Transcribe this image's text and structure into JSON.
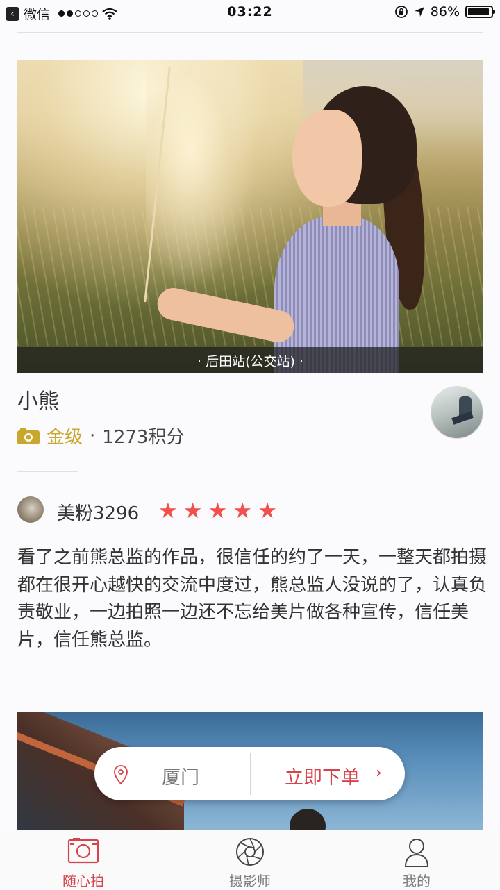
{
  "status_bar": {
    "carrier": "微信",
    "time": "03:22",
    "battery": "86%"
  },
  "photo": {
    "location_caption": "· 后田站(公交站) ·"
  },
  "photographer": {
    "name": "小熊",
    "level": "金级",
    "separator": "·",
    "points": "1273积分"
  },
  "review": {
    "reviewer": "美粉3296",
    "rating": 5,
    "stars": [
      "★",
      "★",
      "★",
      "★",
      "★"
    ],
    "text": "看了之前熊总监的作品，很信任的约了一天，一整天都拍摄都在很开心越快的交流中度过，熊总监人没说的了，认真负责敬业，一边拍照一边还不忘给美片做各种宣传，信任美片，信任熊总监。"
  },
  "order_bar": {
    "city": "厦门",
    "order_label": "立即下单",
    "arrow": "›"
  },
  "tabs": [
    {
      "label": "随心拍",
      "icon": "camera-frame-icon",
      "active": true
    },
    {
      "label": "摄影师",
      "icon": "aperture-icon",
      "active": false
    },
    {
      "label": "我的",
      "icon": "person-icon",
      "active": false
    }
  ],
  "colors": {
    "accent": "#d5444d",
    "gold": "#c9a72c",
    "star": "#f1504c"
  }
}
